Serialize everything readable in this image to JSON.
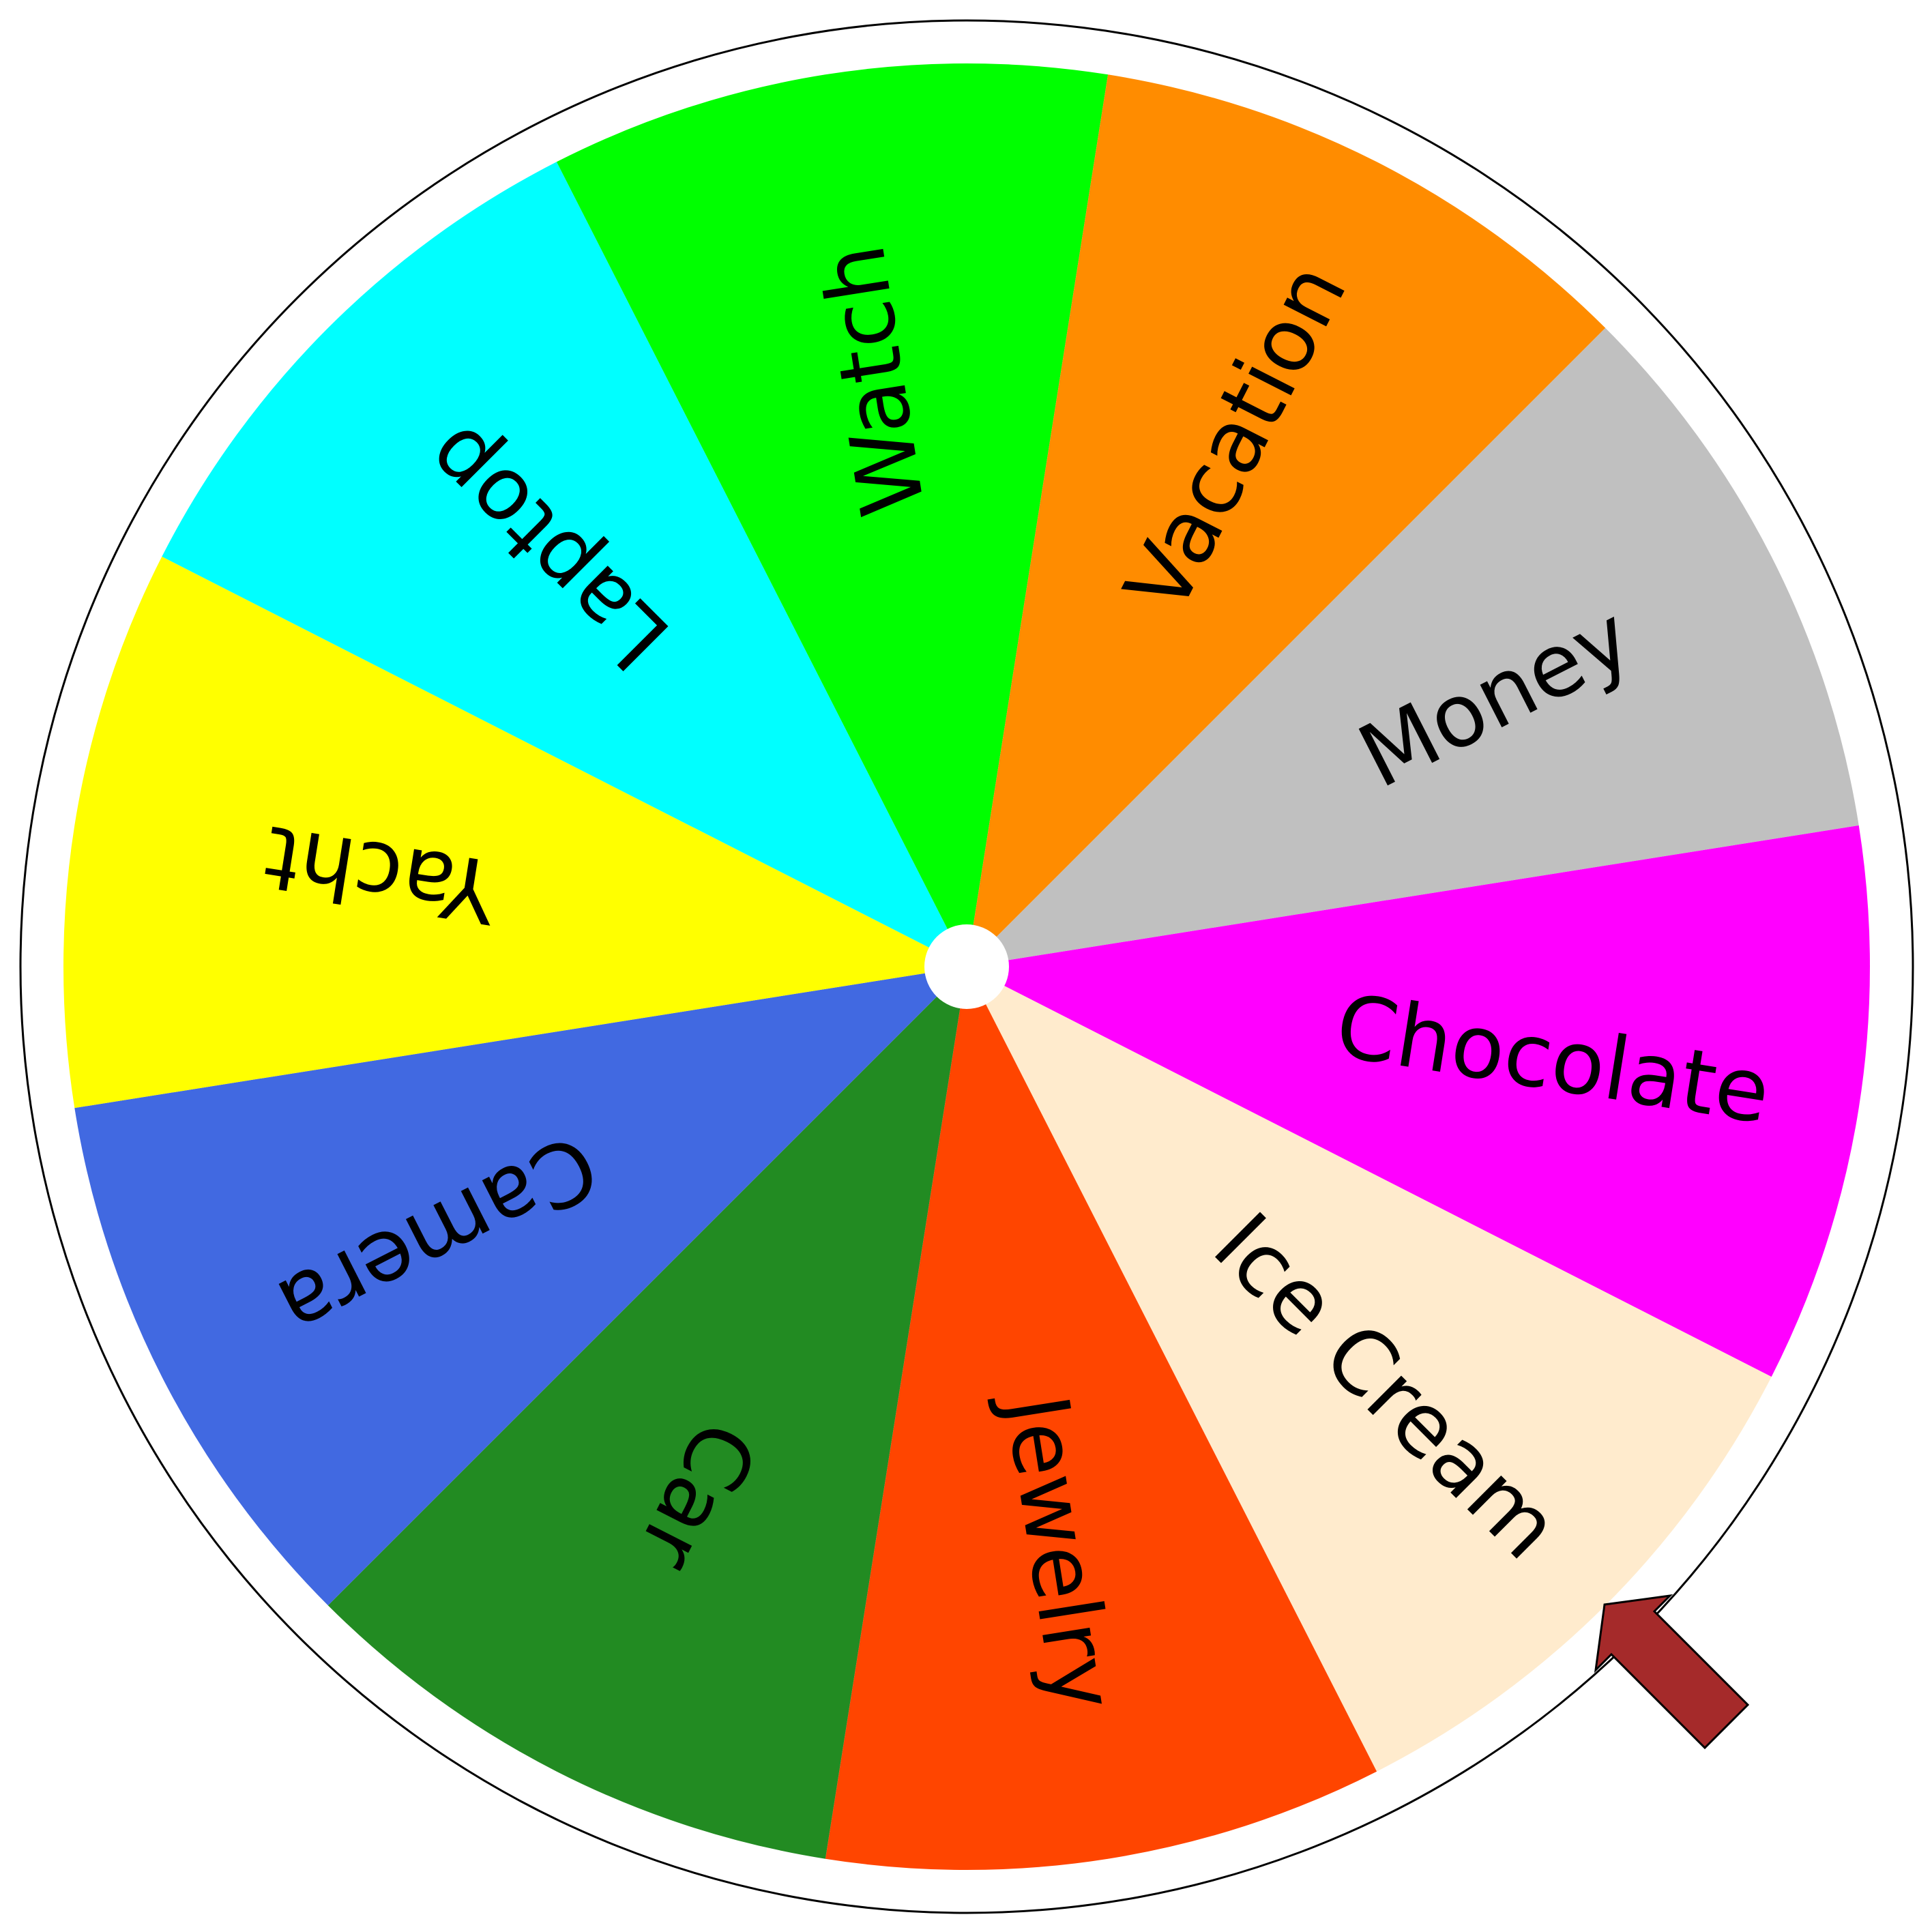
{
  "wheel": {
    "segments": [
      {
        "label": "Chocolate",
        "color": "#ff00ff"
      },
      {
        "label": "Ice Cream",
        "color": "#ffebcd"
      },
      {
        "label": "Jewelry",
        "color": "#ff4500"
      },
      {
        "label": "Car",
        "color": "#228b22"
      },
      {
        "label": "Camera",
        "color": "#4169e1"
      },
      {
        "label": "Yacht",
        "color": "#ffff00"
      },
      {
        "label": "Laptop",
        "color": "#00ffff"
      },
      {
        "label": "Watch",
        "color": "#00ff00"
      },
      {
        "label": "Vacation",
        "color": "#ff8c00"
      },
      {
        "label": "Money",
        "color": "#c0c0c0"
      }
    ],
    "rim_color": "#ffffff",
    "rim_stroke_color": "#000000",
    "hub_color": "#ffffff",
    "pointer": {
      "icon": "arrow-icon",
      "color": "#a52a2a"
    }
  }
}
